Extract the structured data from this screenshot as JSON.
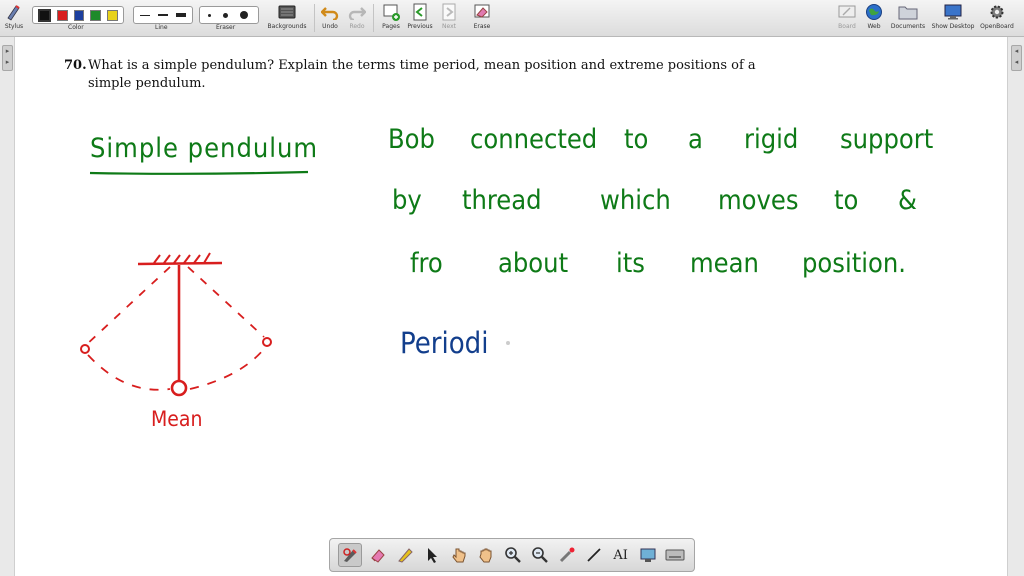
{
  "toolbar": {
    "stylus_label": "Stylus",
    "color_label": "Color",
    "line_label": "Line",
    "eraser_label": "Eraser",
    "backgrounds_label": "Backgrounds",
    "undo_label": "Undo",
    "redo_label": "Redo",
    "pages_label": "Pages",
    "previous_label": "Previous",
    "next_label": "Next",
    "erase_label": "Erase",
    "board_label": "Board",
    "web_label": "Web",
    "documents_label": "Documents",
    "show_desktop_label": "Show Desktop",
    "openboard_label": "OpenBoard",
    "colors": [
      "#111111",
      "#d81e1e",
      "#1c3f9e",
      "#1e8a2a",
      "#e8d21a"
    ]
  },
  "question": {
    "number": "70.",
    "line1": "What is a simple pendulum? Explain the terms time period, mean position and extreme positions of a",
    "line2": "simple pendulum."
  },
  "ink": {
    "heading": "Simple pendulum",
    "def_line1_words": [
      "Bob",
      "connected",
      "to",
      "a",
      "rigid",
      "support"
    ],
    "def_line2_words": [
      "by",
      "thread",
      "which",
      "moves",
      "to",
      "&"
    ],
    "def_line3_words": [
      "fro",
      "about",
      "its",
      "mean",
      "position."
    ],
    "mean_label": "Mean",
    "periodic_partial": "Periodi",
    "colors": {
      "green": "#0e7a17",
      "red": "#d81e1e",
      "blue": "#123e8c"
    }
  },
  "float_toolbar": {
    "tools": [
      "pen-icon",
      "eraser-icon",
      "highlighter-icon",
      "pointer-icon",
      "hand-pointer-icon",
      "hand-grab-icon",
      "zoom-in-icon",
      "zoom-out-icon",
      "laser-pointer-icon",
      "line-tool-icon",
      "text-tool-icon",
      "capture-icon",
      "virtual-keyboard-icon"
    ],
    "text_tool_glyph": "AI"
  }
}
